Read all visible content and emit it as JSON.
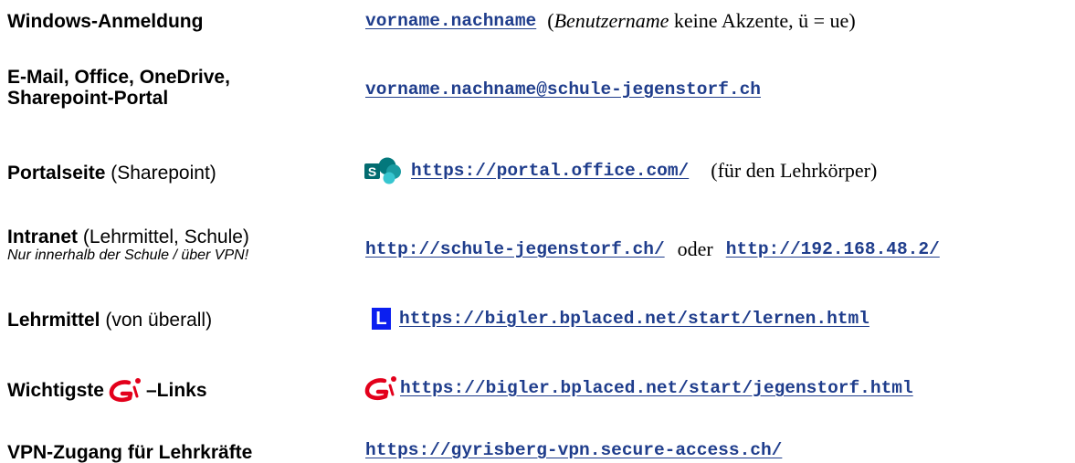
{
  "rows": [
    {
      "left": {
        "label": "Windows-Anmeldung"
      },
      "right": {
        "link": "vorname.nachname",
        "paren_open": "(",
        "italic": "Benutzername",
        "suffix": " keine Akzente, ü = ue)"
      }
    },
    {
      "left": {
        "label_line1": "E-Mail, Office, OneDrive,",
        "label_line2": "Sharepoint-Portal"
      },
      "right": {
        "link": "vorname.nachname@schule-jegenstorf.ch"
      }
    },
    {
      "left": {
        "bold": "Portalseite",
        "normal": " (Sharepoint)"
      },
      "right": {
        "icon": "sharepoint-icon",
        "link": "https://portal.office.com/",
        "suffix": "(für den Lehrkörper)"
      }
    },
    {
      "left": {
        "bold": "Intranet",
        "normal": " (Lehrmittel, Schule)",
        "note": "Nur innerhalb der Schule / über VPN!"
      },
      "right": {
        "link": "http://schule-jegenstorf.ch/",
        "middle": "oder",
        "link2": "http://192.168.48.2/"
      }
    },
    {
      "left": {
        "bold": "Lehrmittel",
        "normal": " (von überall)"
      },
      "right": {
        "icon": "l-square-icon",
        "icon_letter": "L",
        "link": "https://bigler.bplaced.net/start/lernen.html"
      }
    },
    {
      "left": {
        "prefix": "Wichtigste",
        "icon": "school-logo-icon",
        "suffix": "–Links"
      },
      "right": {
        "icon": "school-logo-icon",
        "link": "https://bigler.bplaced.net/start/jegenstorf.html"
      }
    },
    {
      "left": {
        "label": "VPN-Zugang für Lehrkräfte"
      },
      "right": {
        "link": "https://gyrisberg-vpn.secure-access.ch/"
      }
    }
  ],
  "colors": {
    "link": "#1f3d8c",
    "logo_red": "#e3001b",
    "l_blue": "#0b1ff0",
    "sp_dark": "#03787c",
    "sp_mid": "#1a9ba1",
    "sp_light": "#37c6d0"
  }
}
